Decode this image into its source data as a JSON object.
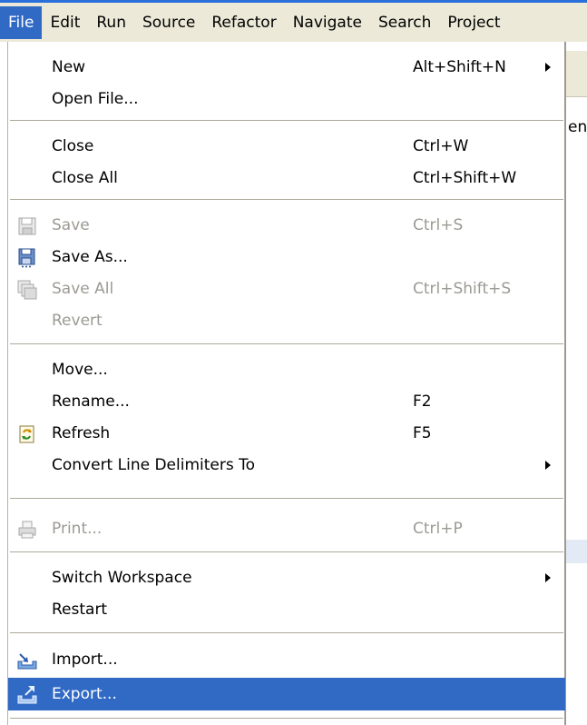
{
  "menubar": {
    "menus": [
      "File",
      "Edit",
      "Run",
      "Source",
      "Refactor",
      "Navigate",
      "Search",
      "Project"
    ]
  },
  "background": {
    "partial_text": "en"
  },
  "file_menu": {
    "items": [
      {
        "label": "New",
        "accel": "Alt+Shift+N",
        "submenu": true
      },
      {
        "label": "Open File...",
        "accel": ""
      },
      {
        "label": "Close",
        "accel": "Ctrl+W"
      },
      {
        "label": "Close All",
        "accel": "Ctrl+Shift+W"
      },
      {
        "label": "Save",
        "accel": "Ctrl+S",
        "disabled": true,
        "icon": "save-icon"
      },
      {
        "label": "Save As...",
        "accel": "",
        "icon": "save-as-icon"
      },
      {
        "label": "Save All",
        "accel": "Ctrl+Shift+S",
        "disabled": true,
        "icon": "save-all-icon"
      },
      {
        "label": "Revert",
        "accel": "",
        "disabled": true
      },
      {
        "label": "Move...",
        "accel": ""
      },
      {
        "label": "Rename...",
        "accel": "F2"
      },
      {
        "label": "Refresh",
        "accel": "F5",
        "icon": "refresh-icon"
      },
      {
        "label": "Convert Line Delimiters To",
        "accel": "",
        "submenu": true
      },
      {
        "label": "Print...",
        "accel": "Ctrl+P",
        "disabled": true,
        "icon": "print-icon"
      },
      {
        "label": "Switch Workspace",
        "accel": "",
        "submenu": true
      },
      {
        "label": "Restart",
        "accel": ""
      },
      {
        "label": "Import...",
        "accel": "",
        "icon": "import-icon"
      },
      {
        "label": "Export...",
        "accel": "",
        "icon": "export-icon",
        "selected": true
      }
    ]
  },
  "colors": {
    "menubar_bg": "#ece9d8",
    "selection": "#316ac5",
    "disabled_text": "#9c9a94"
  }
}
